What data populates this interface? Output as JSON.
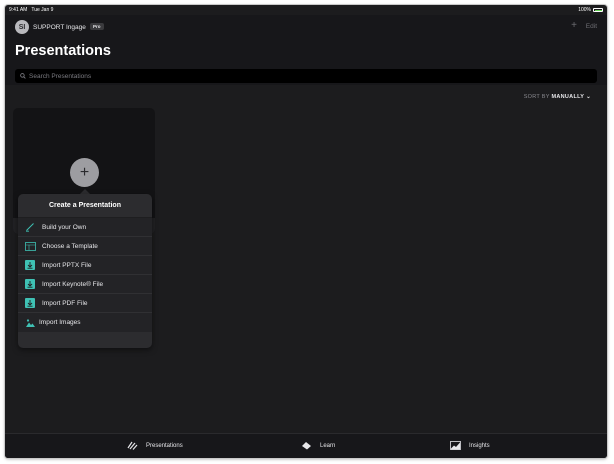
{
  "status_bar": {
    "time": "9:41 AM",
    "date": "Tue Jan 9",
    "battery_pct": "100%",
    "battery_color": "#6bd35b"
  },
  "header": {
    "avatar_initials": "SI",
    "org_name": "SUPPORT Ingage",
    "plan_badge": "Pro",
    "add_icon": "plus-icon",
    "edit_label": "Edit",
    "title": "Presentations",
    "search_placeholder": "Search Presentations"
  },
  "sort": {
    "prefix": "SORT BY",
    "value": "MANUALLY"
  },
  "create_menu": {
    "add_icon": "plus-circle-icon",
    "title": "Create a Presentation",
    "items": [
      {
        "label": "Build your Own",
        "icon": "pencil-icon"
      },
      {
        "label": "Choose a Template",
        "icon": "template-icon"
      },
      {
        "label": "Import PPTX File",
        "icon": "import-file-icon"
      },
      {
        "label": "Import Keynote® File",
        "icon": "import-file-icon"
      },
      {
        "label": "Import PDF File",
        "icon": "import-file-icon"
      },
      {
        "label": "Import Images",
        "icon": "image-icon"
      }
    ],
    "accent_color": "#3fc1b4"
  },
  "tab_bar": {
    "tabs": [
      {
        "label": "Presentations",
        "icon": "presentations-icon"
      },
      {
        "label": "Learn",
        "icon": "learn-icon"
      },
      {
        "label": "Insights",
        "icon": "insights-icon"
      }
    ]
  }
}
